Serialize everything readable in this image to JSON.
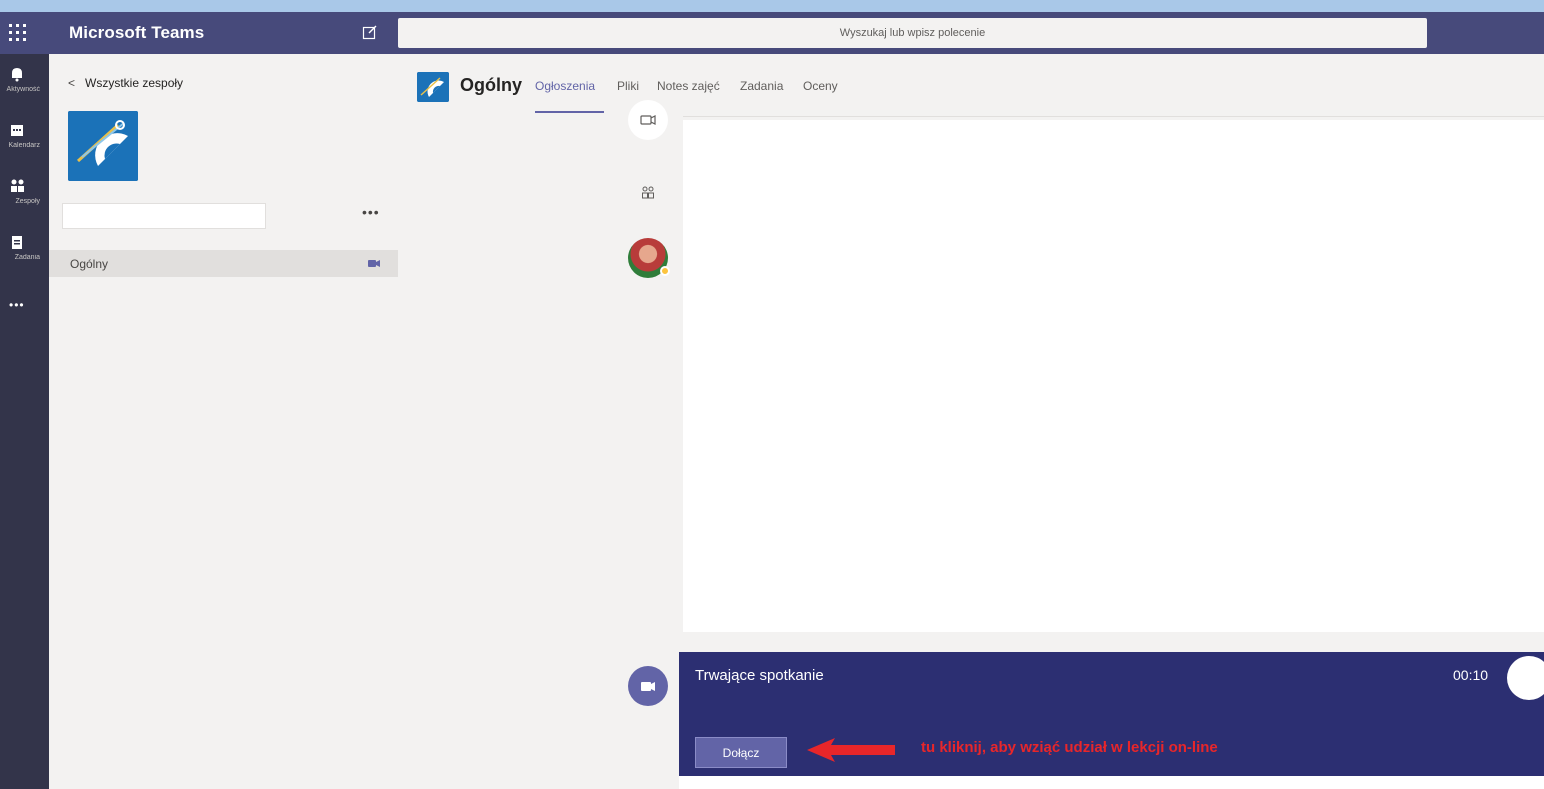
{
  "app": {
    "title": "Microsoft Teams",
    "search_placeholder": "Wyszukaj lub wpisz polecenie"
  },
  "rail": {
    "items": [
      {
        "label": "Aktywność",
        "icon": "bell-icon"
      },
      {
        "label": "Kalendarz",
        "icon": "calendar-icon"
      },
      {
        "label": "Zespoły",
        "icon": "teams-icon"
      },
      {
        "label": "Zadania",
        "icon": "assignments-icon"
      }
    ],
    "more": "•••"
  },
  "team_panel": {
    "back_label": "Wszystkie zespoły",
    "more_label": "•••",
    "channels": [
      {
        "name": "Ogólny",
        "has_meeting": true
      }
    ]
  },
  "channel": {
    "title": "Ogólny",
    "tabs": [
      {
        "label": "Ogłoszenia",
        "active": true
      },
      {
        "label": "Pliki",
        "active": false
      },
      {
        "label": "Notes zajęć",
        "active": false
      },
      {
        "label": "Zadania",
        "active": false
      },
      {
        "label": "Oceny",
        "active": false
      }
    ]
  },
  "meeting": {
    "title": "Trwające spotkanie",
    "duration": "00:10",
    "join_label": "Dołącz",
    "instruction": "tu kliknij, aby wziąć udział w lekcji on-line"
  },
  "colors": {
    "brand": "#6264a7",
    "topbar": "#474a7b",
    "rail": "#33344a",
    "banner": "#2c2f72",
    "instruction": "#e8262a"
  }
}
